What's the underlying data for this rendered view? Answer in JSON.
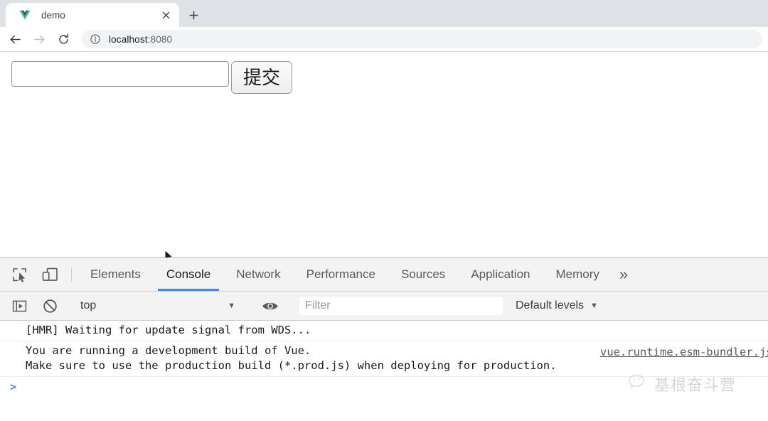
{
  "browser": {
    "tab": {
      "title": "demo",
      "favicon": "vue-logo-icon",
      "close_label": "×"
    },
    "newtab_label": "+",
    "nav": {
      "back": "←",
      "forward": "→",
      "reload": "⟳"
    },
    "omnibox": {
      "info_icon": "info-circle-icon",
      "host": "localhost",
      "port": ":8080"
    }
  },
  "page": {
    "input_value": "",
    "input_placeholder": "",
    "submit_label": "提交"
  },
  "devtools": {
    "tabs": [
      {
        "label": "Elements",
        "active": false
      },
      {
        "label": "Console",
        "active": true
      },
      {
        "label": "Network",
        "active": false
      },
      {
        "label": "Performance",
        "active": false
      },
      {
        "label": "Sources",
        "active": false
      },
      {
        "label": "Application",
        "active": false
      },
      {
        "label": "Memory",
        "active": false
      }
    ],
    "more_label": "»",
    "toolbar": {
      "context": "top",
      "context_caret": "▼",
      "filter_placeholder": "Filter",
      "filter_value": "",
      "levels_label": "Default levels",
      "levels_caret": "▼"
    },
    "console": {
      "messages": [
        {
          "text": "[HMR] Waiting for update signal from WDS...",
          "source": ""
        },
        {
          "text": "You are running a development build of Vue.\nMake sure to use the production build (*.prod.js) when deploying for production.",
          "source": "vue.runtime.esm-bundler.js"
        }
      ],
      "prompt": ">"
    }
  },
  "watermark": {
    "text": "基根奋斗营",
    "logo": "wechat-icon"
  },
  "colors": {
    "accent": "#4285f4",
    "chrome_bg": "#dee1e6",
    "devtools_bg": "#f3f3f3",
    "vue_green": "#42b883"
  }
}
